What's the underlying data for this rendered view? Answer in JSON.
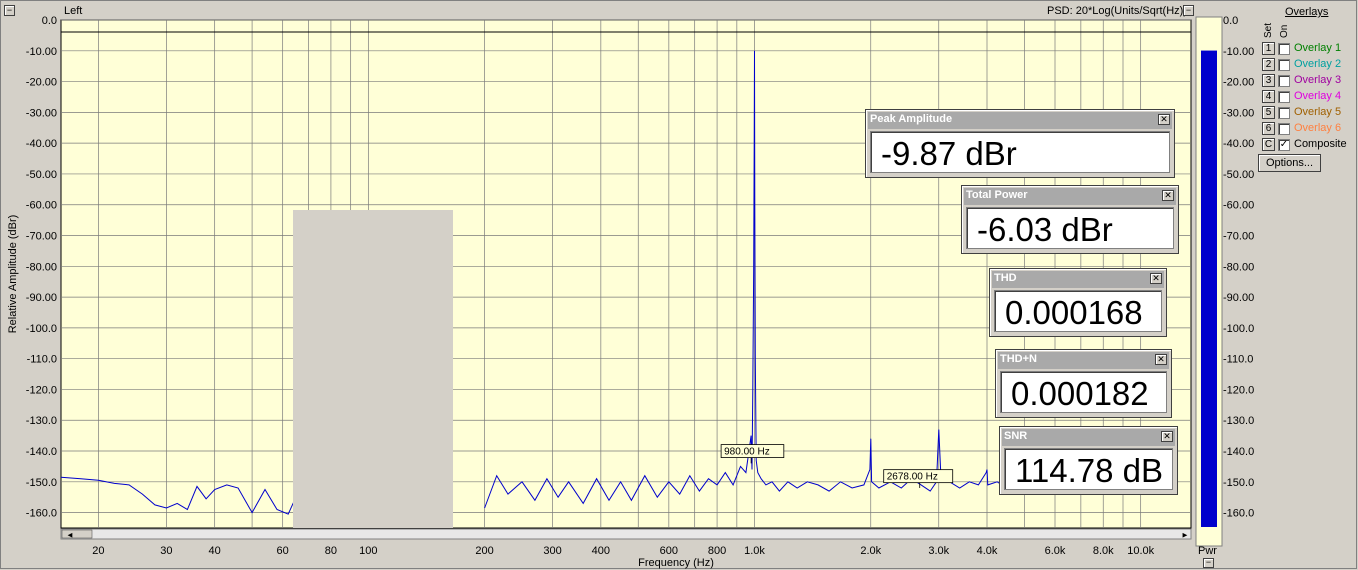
{
  "window": {
    "channel_label": "Left",
    "psd_label": "PSD: 20*Log(Units/Sqrt(Hz))"
  },
  "chart_data": {
    "type": "line",
    "xlabel": "Frequency (Hz)",
    "ylabel": "Relative Amplitude (dBr)",
    "x_scale": "log",
    "xlim": [
      16,
      13500
    ],
    "ylim": [
      -165,
      0
    ],
    "grid": true,
    "x_ticks": [
      {
        "value": 20,
        "label": "20"
      },
      {
        "value": 30,
        "label": "30"
      },
      {
        "value": 40,
        "label": "40"
      },
      {
        "value": 60,
        "label": "60"
      },
      {
        "value": 80,
        "label": "80"
      },
      {
        "value": 100,
        "label": "100"
      },
      {
        "value": 200,
        "label": "200"
      },
      {
        "value": 300,
        "label": "300"
      },
      {
        "value": 400,
        "label": "400"
      },
      {
        "value": 600,
        "label": "600"
      },
      {
        "value": 800,
        "label": "800"
      },
      {
        "value": 1000,
        "label": "1.0k"
      },
      {
        "value": 2000,
        "label": "2.0k"
      },
      {
        "value": 3000,
        "label": "3.0k"
      },
      {
        "value": 4000,
        "label": "4.0k"
      },
      {
        "value": 6000,
        "label": "6.0k"
      },
      {
        "value": 8000,
        "label": "8.0k"
      },
      {
        "value": 10000,
        "label": "10.0k"
      }
    ],
    "y_ticks": [
      {
        "value": 0,
        "label": "0.0"
      },
      {
        "value": -10,
        "label": "-10.00"
      },
      {
        "value": -20,
        "label": "-20.00"
      },
      {
        "value": -30,
        "label": "-30.00"
      },
      {
        "value": -40,
        "label": "-40.00"
      },
      {
        "value": -50,
        "label": "-50.00"
      },
      {
        "value": -60,
        "label": "-60.00"
      },
      {
        "value": -70,
        "label": "-70.00"
      },
      {
        "value": -80,
        "label": "-80.00"
      },
      {
        "value": -90,
        "label": "-90.00"
      },
      {
        "value": -100,
        "label": "-100.0"
      },
      {
        "value": -110,
        "label": "-110.0"
      },
      {
        "value": -120,
        "label": "-120.0"
      },
      {
        "value": -130,
        "label": "-130.0"
      },
      {
        "value": -140,
        "label": "-140.0"
      },
      {
        "value": -150,
        "label": "-150.0"
      },
      {
        "value": -160,
        "label": "-160.0"
      }
    ],
    "series": [
      {
        "color": "#0000cc",
        "x": [
          16,
          18,
          20,
          22,
          24,
          26,
          28,
          30,
          32,
          34,
          36,
          38,
          40,
          43,
          46,
          50,
          54,
          58,
          62,
          66,
          70,
          72,
          200,
          215,
          230,
          250,
          270,
          290,
          310,
          330,
          360,
          390,
          420,
          450,
          480,
          520,
          560,
          600,
          640,
          680,
          720,
          760,
          800,
          840,
          880,
          920,
          950,
          970,
          980,
          985,
          990,
          995,
          998,
          1000,
          1002,
          1005,
          1010,
          1020,
          1040,
          1070,
          1110,
          1160,
          1220,
          1290,
          1370,
          1460,
          1560,
          1670,
          1790,
          1920,
          1990,
          2000,
          2010,
          2100,
          2250,
          2400,
          2550,
          2700,
          2850,
          2960,
          3000,
          3040,
          3200,
          3400,
          3600,
          3800,
          3980,
          4000,
          4020,
          4250,
          4500,
          4800,
          5100,
          5400,
          5700,
          6000
        ],
        "y": [
          -148.5,
          -149,
          -149.5,
          -150.5,
          -151,
          -154,
          -157.5,
          -158.5,
          -157,
          -159,
          -151.5,
          -155.5,
          -152.5,
          -151,
          -152,
          -160,
          -152.5,
          -159,
          -160.5,
          -153,
          -157,
          -152,
          -158.5,
          -148,
          -154,
          -150,
          -156,
          -149,
          -155,
          -150,
          -157,
          -149,
          -156,
          -150,
          -156,
          -148,
          -155,
          -150,
          -154,
          -148,
          -153,
          -149,
          -151,
          -147,
          -151,
          -145,
          -147,
          -139,
          -135,
          -146,
          -120,
          -80,
          -40,
          -10,
          -60,
          -110,
          -143,
          -147,
          -149,
          -151,
          -150,
          -153,
          -150,
          -152,
          -150,
          -151,
          -153,
          -150,
          -152,
          -151,
          -146,
          -136,
          -150,
          -152,
          -150,
          -152,
          -149,
          -151,
          -153,
          -150,
          -133,
          -149,
          -150,
          -152,
          -150,
          -151,
          -147,
          -146,
          -151,
          -150,
          -152,
          -150,
          -151,
          -152,
          -150,
          -151
        ]
      }
    ],
    "annotations": [
      {
        "label": "980.00 Hz",
        "x": 980,
        "y": -144
      },
      {
        "label": "2678.00 Hz",
        "x": 2678,
        "y": -152
      }
    ]
  },
  "readouts": [
    {
      "name": "peak-amplitude",
      "title": "Peak Amplitude",
      "value": "-9.87 dBr"
    },
    {
      "name": "total-power",
      "title": "Total Power",
      "value": "-6.03 dBr"
    },
    {
      "name": "thd",
      "title": "THD",
      "value": "0.000168"
    },
    {
      "name": "thd-n",
      "title": "THD+N",
      "value": "0.000182"
    },
    {
      "name": "snr",
      "title": "SNR",
      "value": "114.78 dB"
    }
  ],
  "power_meter": {
    "label": "Pwr",
    "color": "#0000cc",
    "level_dbr": -6.03,
    "ticks": [
      "0.0",
      "-10.00",
      "-20.00",
      "-30.00",
      "-40.00",
      "-50.00",
      "-60.00",
      "-70.00",
      "-80.00",
      "-90.00",
      "-100.0",
      "-110.0",
      "-120.0",
      "-130.0",
      "-140.0",
      "-150.0",
      "-160.0"
    ]
  },
  "overlays": {
    "title": "Overlays",
    "set_label": "Set",
    "on_label": "On",
    "items": [
      {
        "set": "1",
        "label": "Overlay 1",
        "color": "#008000",
        "checked": false
      },
      {
        "set": "2",
        "label": "Overlay 2",
        "color": "#00a0a0",
        "checked": false
      },
      {
        "set": "3",
        "label": "Overlay 3",
        "color": "#a000a0",
        "checked": false
      },
      {
        "set": "4",
        "label": "Overlay 4",
        "color": "#e000e0",
        "checked": false
      },
      {
        "set": "5",
        "label": "Overlay 5",
        "color": "#a06000",
        "checked": false
      },
      {
        "set": "6",
        "label": "Overlay 6",
        "color": "#ff8040",
        "checked": false
      },
      {
        "set": "C",
        "label": "Composite",
        "color": "#000000",
        "checked": true
      }
    ],
    "options_label": "Options..."
  },
  "controls": {
    "minimize_symbol": "−",
    "check_symbol": "✓",
    "close_symbol": "✕",
    "scroll_left": "◄",
    "scroll_right": "►"
  }
}
